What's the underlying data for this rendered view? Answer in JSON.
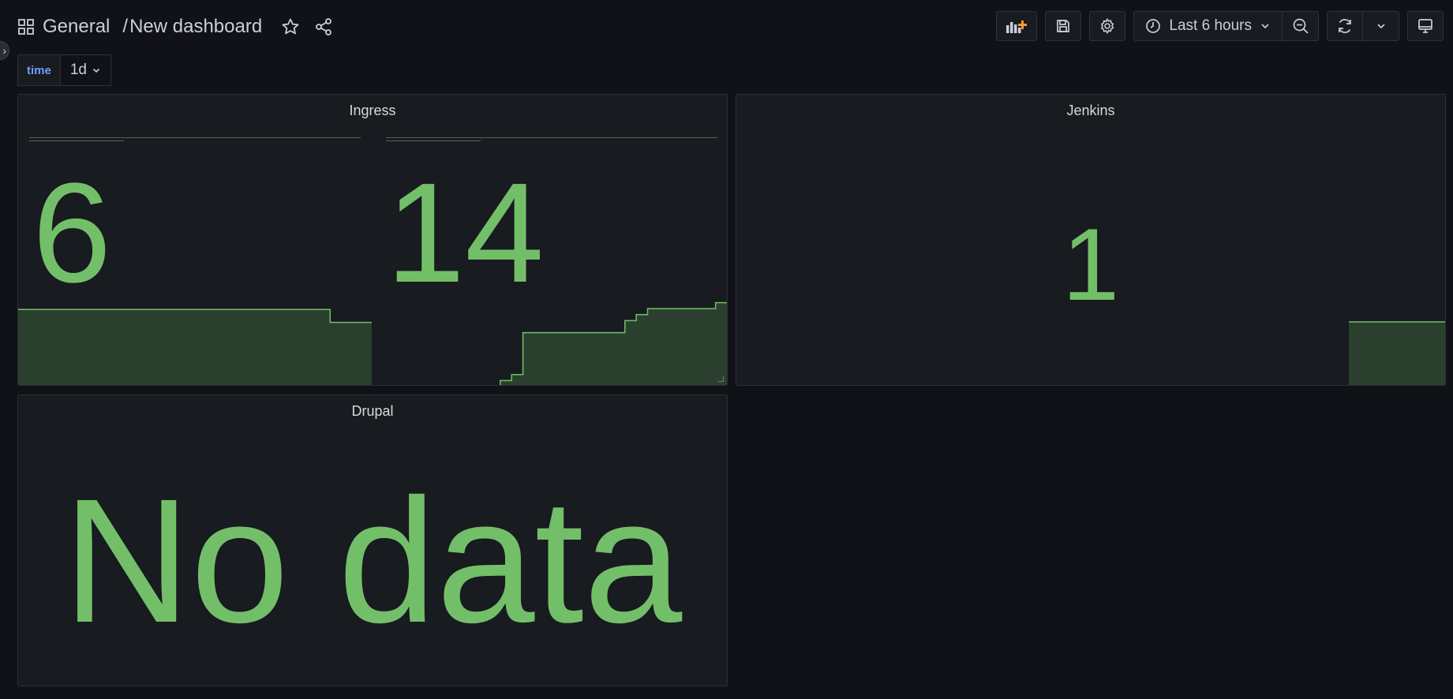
{
  "header": {
    "folder": "General",
    "separator": "/",
    "title": "New dashboard",
    "time_range": "Last 6 hours"
  },
  "variables": [
    {
      "label": "time",
      "value": "1d"
    }
  ],
  "panels": {
    "ingress": {
      "title": "Ingress",
      "stats": [
        {
          "value": "6",
          "sparkline_y": [
            6,
            6,
            6,
            6,
            6,
            6,
            6,
            6,
            6,
            6,
            6,
            6,
            6,
            6,
            6,
            6,
            6,
            6,
            6,
            6,
            6,
            6,
            6,
            6,
            6,
            6,
            6,
            6,
            6,
            6,
            5,
            5,
            5,
            5,
            5
          ]
        },
        {
          "value": "14",
          "sparkline_y": [
            0,
            1,
            2,
            9,
            9,
            9,
            9,
            9,
            9,
            9,
            9,
            9,
            11,
            12,
            13,
            13,
            13,
            13,
            13,
            13,
            14,
            14
          ]
        }
      ]
    },
    "jenkins": {
      "title": "Jenkins",
      "value": "1"
    },
    "drupal": {
      "title": "Drupal",
      "value": "No data"
    }
  },
  "colors": {
    "background": "#111217",
    "panel": "#181b1f",
    "stat_green": "#73bf69",
    "accent_blue": "#6e9fff",
    "star_orange": "#ff9830"
  },
  "icons": [
    "dashboard-grid-icon",
    "star-icon",
    "share-icon",
    "add-panel-icon",
    "save-icon",
    "gear-icon",
    "clock-icon",
    "chevron-down-icon",
    "zoom-out-icon",
    "refresh-icon",
    "tv-mode-icon",
    "chevron-right-icon"
  ]
}
